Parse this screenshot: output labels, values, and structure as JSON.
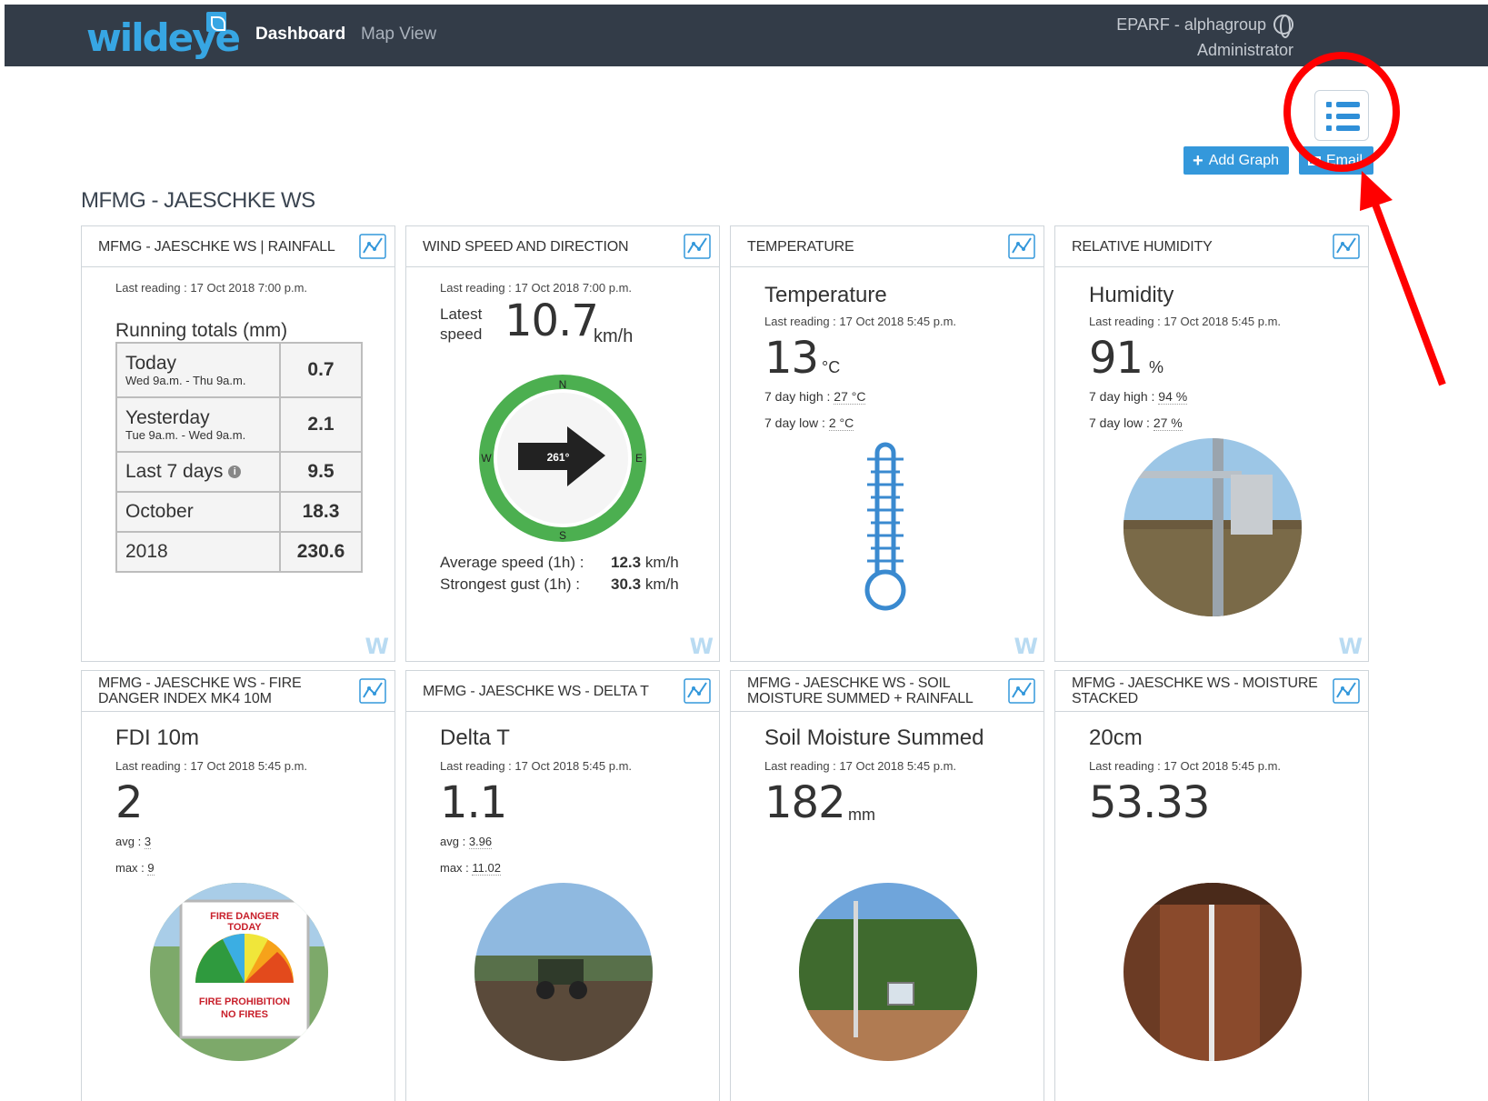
{
  "app": {
    "logo": "wildeye"
  },
  "nav": {
    "dashboard": "Dashboard",
    "map_view": "Map View"
  },
  "account": {
    "org": "EPARF - alphagroup",
    "role": "Administrator"
  },
  "toolbar": {
    "add_graph": "Add Graph",
    "email": "Email"
  },
  "station": "MFMG - JAESCHKE WS",
  "cards": {
    "rainfall": {
      "header": "MFMG - JAESCHKE WS | RAINFALL",
      "last_reading": "Last reading : 17 Oct 2018 7:00 p.m.",
      "title": "Running totals (mm)",
      "rows": [
        {
          "label": "Today",
          "sub": "Wed 9a.m. - Thu 9a.m.",
          "value": "0.7"
        },
        {
          "label": "Yesterday",
          "sub": "Tue 9a.m. - Wed 9a.m.",
          "value": "2.1"
        },
        {
          "label": "Last 7 days",
          "sub": "",
          "value": "9.5"
        },
        {
          "label": "October",
          "sub": "",
          "value": "18.3"
        },
        {
          "label": "2018",
          "sub": "",
          "value": "230.6"
        }
      ]
    },
    "wind": {
      "header": "WIND SPEED AND DIRECTION",
      "last_reading": "Last reading : 17 Oct 2018 7:00 p.m.",
      "latest_label_1": "Latest",
      "latest_label_2": "speed",
      "speed": "10.7",
      "unit": "km/h",
      "direction": "261°",
      "direction_deg": 261,
      "compass": {
        "n": "N",
        "e": "E",
        "s": "S",
        "w": "W"
      },
      "avg_label": "Average speed (1h) :",
      "avg_value": "12.3",
      "gust_label": "Strongest gust (1h) :",
      "gust_value": "30.3",
      "stat_unit": "km/h"
    },
    "temperature": {
      "header": "TEMPERATURE",
      "title": "Temperature",
      "last_reading": "Last reading : 17 Oct 2018 5:45 p.m.",
      "value": "13",
      "unit": "°C",
      "high_label": "7 day high :",
      "high_value": "27 °C",
      "low_label": "7 day low :",
      "low_value": "2 °C"
    },
    "humidity": {
      "header": "RELATIVE HUMIDITY",
      "title": "Humidity",
      "last_reading": "Last reading : 17 Oct 2018 5:45 p.m.",
      "value": "91",
      "unit": "%",
      "high_label": "7 day high :",
      "high_value": "94 %",
      "low_label": "7 day low :",
      "low_value": "27 %"
    },
    "fdi": {
      "header": "MFMG - JAESCHKE WS - FIRE DANGER INDEX MK4 10M",
      "title": "FDI 10m",
      "last_reading": "Last reading : 17 Oct 2018 5:45 p.m.",
      "value": "2",
      "avg_label": "avg :",
      "avg_value": "3",
      "max_label": "max :",
      "max_value": "9",
      "sign_line1": "FIRE DANGER",
      "sign_line2": "TODAY",
      "sign_line3": "FIRE PROHIBITION",
      "sign_line4": "NO FIRES"
    },
    "delta": {
      "header": "MFMG - JAESCHKE WS - DELTA T",
      "title": "Delta T",
      "last_reading": "Last reading : 17 Oct 2018 5:45 p.m.",
      "value": "1.1",
      "avg_label": "avg :",
      "avg_value": "3.96",
      "max_label": "max :",
      "max_value": "11.02"
    },
    "soil": {
      "header": "MFMG - JAESCHKE WS - SOIL MOISTURE SUMMED + RAINFALL",
      "title": "Soil Moisture Summed",
      "last_reading": "Last reading : 17 Oct 2018 5:45 p.m.",
      "value": "182",
      "unit": "mm"
    },
    "moisture": {
      "header": "MFMG - JAESCHKE WS - MOISTURE STACKED",
      "title": "20cm",
      "last_reading": "Last reading : 17 Oct 2018 5:45 p.m.",
      "value": "53.33"
    }
  },
  "watermark": "W",
  "colors": {
    "topbar": "#333c48",
    "accent": "#3498db",
    "annotation": "#ff0000",
    "compass_ring": "#4caf50"
  }
}
